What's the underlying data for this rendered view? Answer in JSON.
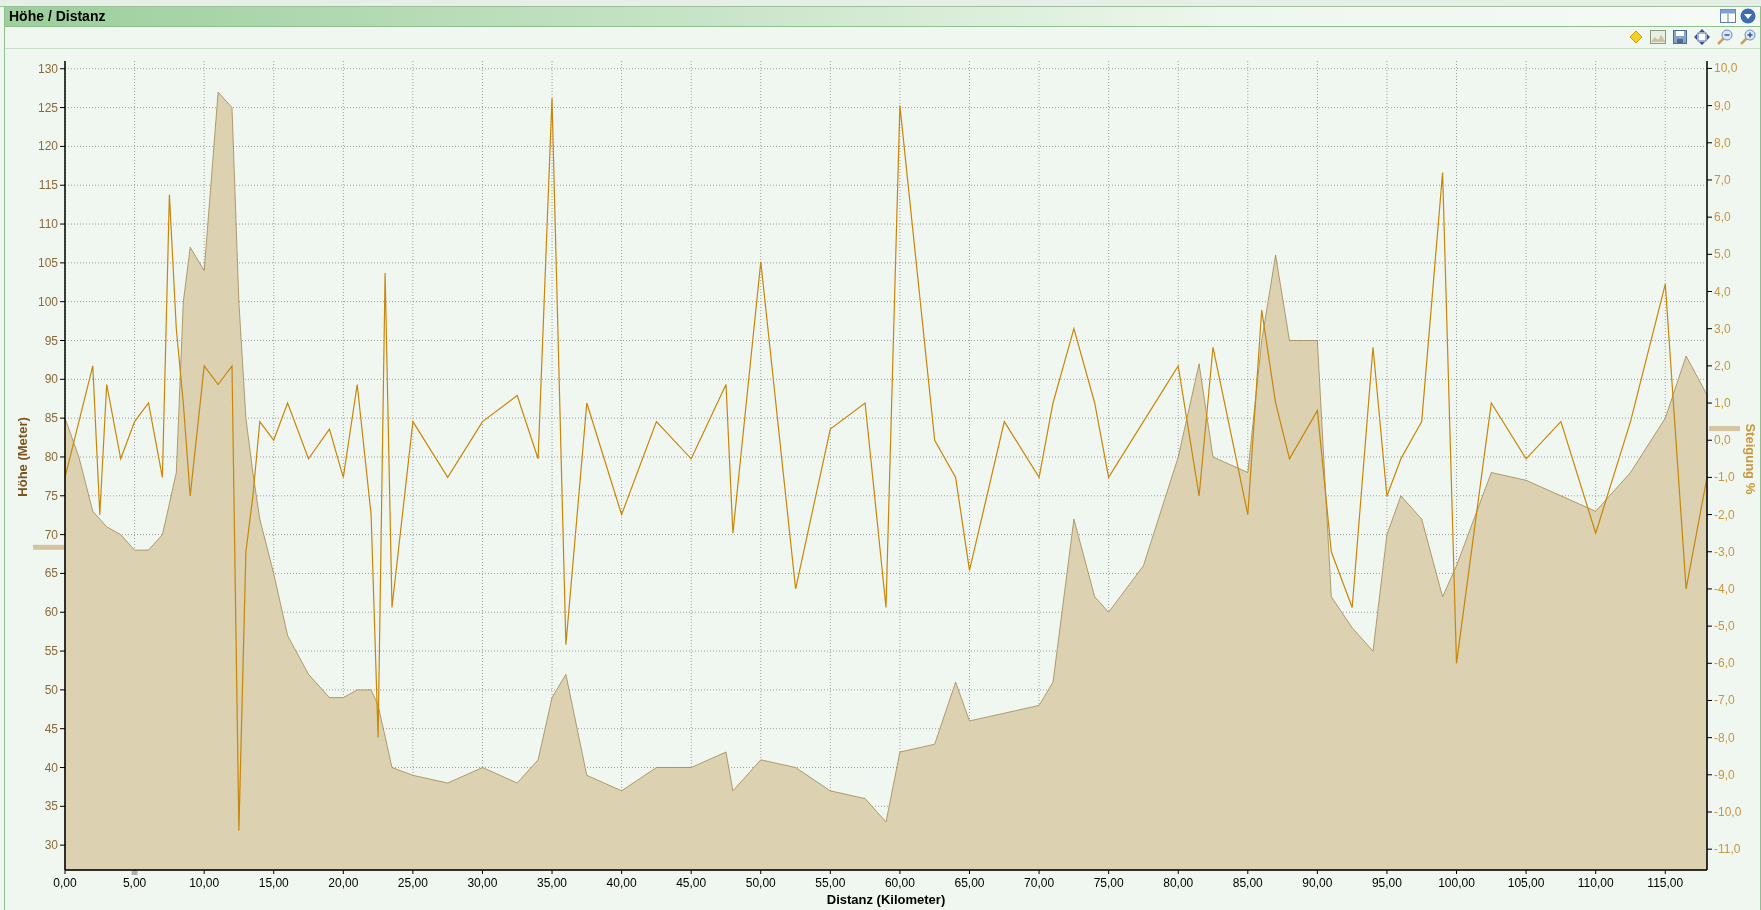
{
  "panel": {
    "title": "Höhe / Distanz"
  },
  "chart": {
    "chart_data": {
      "type": "area",
      "xlabel": "Distanz (Kilometer)",
      "grid": true,
      "xlim": [
        0,
        118
      ],
      "ylim": [
        26.8,
        131
      ],
      "y2lim": [
        -11.56,
        10.2
      ],
      "xticks": [
        {
          "value": 0,
          "label": "0,00"
        },
        {
          "value": 5,
          "label": "5,00"
        },
        {
          "value": 10,
          "label": "10,00"
        },
        {
          "value": 15,
          "label": "15,00"
        },
        {
          "value": 20,
          "label": "20,00"
        },
        {
          "value": 25,
          "label": "25,00"
        },
        {
          "value": 30,
          "label": "30,00"
        },
        {
          "value": 35,
          "label": "35,00"
        },
        {
          "value": 40,
          "label": "40,00"
        },
        {
          "value": 45,
          "label": "45,00"
        },
        {
          "value": 50,
          "label": "50,00"
        },
        {
          "value": 55,
          "label": "55,00"
        },
        {
          "value": 60,
          "label": "60,00"
        },
        {
          "value": 65,
          "label": "65,00"
        },
        {
          "value": 70,
          "label": "70,00"
        },
        {
          "value": 75,
          "label": "75,00"
        },
        {
          "value": 80,
          "label": "80,00"
        },
        {
          "value": 85,
          "label": "85,00"
        },
        {
          "value": 90,
          "label": "90,00"
        },
        {
          "value": 95,
          "label": "95,00"
        },
        {
          "value": 100,
          "label": "100,00"
        },
        {
          "value": 105,
          "label": "105,00"
        },
        {
          "value": 110,
          "label": "110,00"
        },
        {
          "value": 115,
          "label": "115,00"
        }
      ],
      "yticks": [
        30,
        35,
        40,
        45,
        50,
        55,
        60,
        65,
        70,
        75,
        80,
        85,
        90,
        95,
        100,
        105,
        110,
        115,
        120,
        125,
        130
      ],
      "y2ticks": [
        {
          "value": 10,
          "label": "10,0"
        },
        {
          "value": 9,
          "label": "9,0"
        },
        {
          "value": 8,
          "label": "8,0"
        },
        {
          "value": 7,
          "label": "7,0"
        },
        {
          "value": 6,
          "label": "6,0"
        },
        {
          "value": 5,
          "label": "5,0"
        },
        {
          "value": 4,
          "label": "4,0"
        },
        {
          "value": 3,
          "label": "3,0"
        },
        {
          "value": 2,
          "label": "2,0"
        },
        {
          "value": 1,
          "label": "1,0"
        },
        {
          "value": 0,
          "label": "0,0"
        },
        {
          "value": -1,
          "label": "-1,0"
        },
        {
          "value": -2,
          "label": "-2,0"
        },
        {
          "value": -3,
          "label": "-3,0"
        },
        {
          "value": -4,
          "label": "-4,0"
        },
        {
          "value": -5,
          "label": "-5,0"
        },
        {
          "value": -6,
          "label": "-6,0"
        },
        {
          "value": -7,
          "label": "-7,0"
        },
        {
          "value": -8,
          "label": "-8,0"
        },
        {
          "value": -9,
          "label": "-9,0"
        },
        {
          "value": -10,
          "label": "-10,0"
        },
        {
          "value": -11,
          "label": "-11,0"
        }
      ],
      "x": [
        0,
        1,
        2,
        2.5,
        3,
        4,
        5,
        6,
        7,
        7.5,
        8,
        8.5,
        9,
        10,
        11,
        12,
        12.5,
        13,
        13.5,
        14,
        15,
        16,
        17.5,
        19,
        20,
        21,
        22,
        22.5,
        23,
        23.5,
        25,
        27.5,
        30,
        32.5,
        34,
        35,
        36,
        37.5,
        40,
        42.5,
        45,
        47.5,
        48,
        50,
        52.5,
        55,
        57.5,
        59,
        60,
        62.5,
        64,
        65,
        67.5,
        70,
        71,
        72.5,
        74,
        75,
        77.5,
        80,
        81.5,
        82.5,
        85,
        86,
        87,
        88,
        90,
        91,
        92.5,
        94,
        95,
        96,
        97.5,
        99,
        100,
        102.5,
        105,
        107.5,
        110,
        112.5,
        115,
        116.5,
        118
      ],
      "series": [
        {
          "name": "Höhe (Meter)",
          "color": "#8a6a2a",
          "values": [
            85,
            80,
            73,
            72,
            71,
            70,
            68,
            68,
            70,
            74,
            78,
            100,
            107,
            104,
            127,
            125,
            100,
            85,
            78,
            72,
            65,
            57,
            52,
            49,
            49,
            50,
            50,
            48,
            44,
            40,
            39,
            38,
            40,
            38,
            41,
            49,
            52,
            39,
            37,
            40,
            40,
            42,
            37,
            41,
            40,
            37,
            36,
            33,
            42,
            43,
            51,
            46,
            47,
            48,
            51,
            72,
            62,
            60,
            66,
            80,
            92,
            80,
            78,
            95,
            106,
            95,
            95,
            62,
            58,
            55,
            70,
            75,
            72,
            62,
            66,
            78,
            77,
            75,
            73,
            78,
            85,
            93,
            88
          ]
        },
        {
          "name": "Steigung %",
          "type": "line",
          "axis": "y2",
          "color": "#c8860a",
          "values": [
            -1,
            0.5,
            2,
            -2,
            1.5,
            -0.5,
            0.5,
            1,
            -1,
            6.6,
            3,
            1,
            -1.5,
            2,
            1.5,
            2,
            -10.5,
            -3,
            -1.5,
            0.5,
            0,
            1,
            -0.5,
            0.3,
            -1,
            1.5,
            -2,
            -8,
            4.5,
            -4.5,
            0.5,
            -1,
            0.5,
            1.2,
            -0.5,
            9.2,
            -5.5,
            1,
            -2,
            0.5,
            -0.5,
            1.5,
            -2.5,
            4.8,
            -4,
            0.3,
            1,
            -4.5,
            9,
            0,
            -1,
            -3.5,
            0.5,
            -1,
            1,
            3,
            1,
            -1,
            0.5,
            2,
            -1.5,
            2.5,
            -2,
            3.5,
            1,
            -0.5,
            0.8,
            -3,
            -4.5,
            2.5,
            -1.5,
            -0.5,
            0.5,
            7.2,
            -6,
            1,
            -0.5,
            0.5,
            -2.5,
            0.5,
            4.2,
            -4,
            -1
          ]
        }
      ]
    }
  }
}
